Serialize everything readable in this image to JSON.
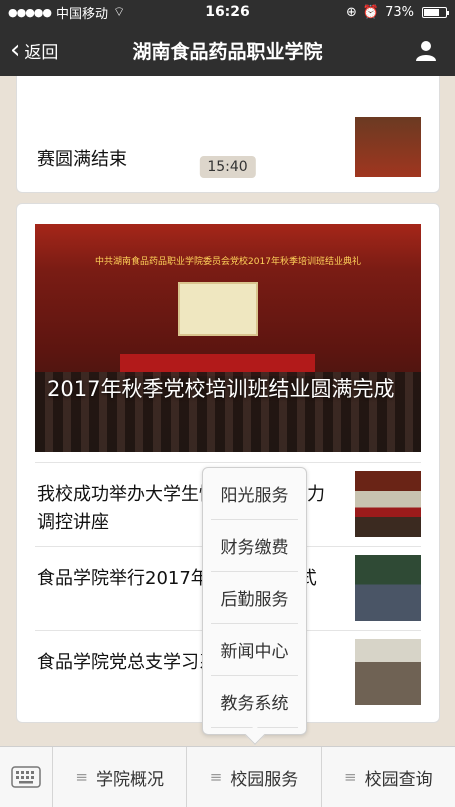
{
  "status": {
    "signal": "●●●●●",
    "carrier": "中国移动",
    "wifi": "⌔",
    "time": "16:26",
    "battery": "73%",
    "battery_level": 0.73
  },
  "nav": {
    "back_label": "返回",
    "title": "湖南食品药品职业学院"
  },
  "chat": {
    "prev_card_text": "赛圆满结束",
    "timestamp": "15:40",
    "article": {
      "cover_banner": "中共湖南食品药品职业学院委员会党校2017年秋季培训班结业典礼",
      "headline": "2017年秋季党校培训班结业圆满完成",
      "items": [
        {
          "title": "我校成功举办大学生情绪管理与压力调控讲座"
        },
        {
          "title": "食品学院举行2017年新生开班仪式"
        },
        {
          "title": "食品学院党总支学习系列党日活动"
        }
      ]
    }
  },
  "popup_menu": {
    "items": [
      "阳光服务",
      "财务缴费",
      "后勤服务",
      "新闻中心",
      "教务系统"
    ]
  },
  "bottom_menu": {
    "items": [
      "学院概况",
      "校园服务",
      "校园查询"
    ],
    "menu_glyph": "≡"
  }
}
